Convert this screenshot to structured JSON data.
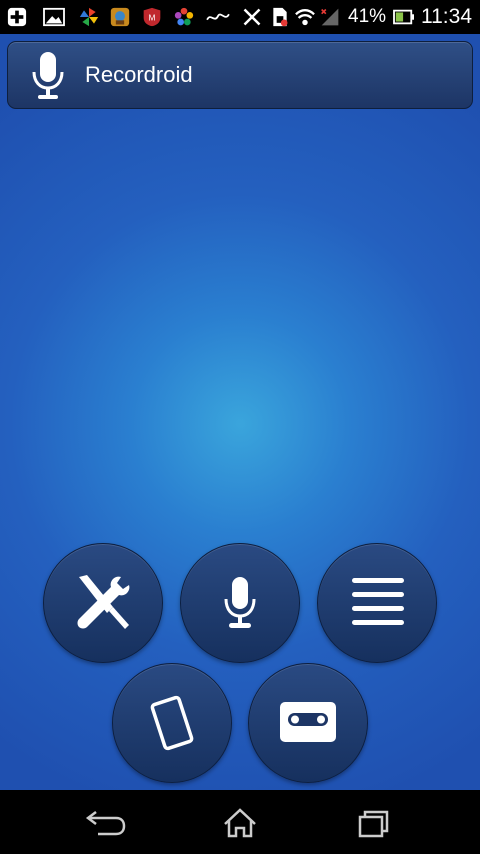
{
  "status_bar": {
    "battery_percent": "41%",
    "time": "11:34",
    "icons": [
      "add-icon",
      "gallery-icon",
      "pinwheel-icon",
      "game-icon",
      "mcafee-icon",
      "flower-icon",
      "arabic-app-icon",
      "bluetooth-off-icon",
      "sim-icon",
      "wifi-icon",
      "signal-icon",
      "battery-icon"
    ]
  },
  "header": {
    "app_title": "Recordroid",
    "icon": "microphone-icon"
  },
  "buttons": [
    {
      "name": "settings-button",
      "icon": "tools-icon"
    },
    {
      "name": "record-button",
      "icon": "microphone-icon"
    },
    {
      "name": "list-button",
      "icon": "menu-lines-icon"
    },
    {
      "name": "device-button",
      "icon": "phone-icon"
    },
    {
      "name": "tape-button",
      "icon": "cassette-icon"
    }
  ],
  "nav_bar": {
    "icons": [
      "back-icon",
      "home-icon",
      "recent-apps-icon"
    ]
  }
}
